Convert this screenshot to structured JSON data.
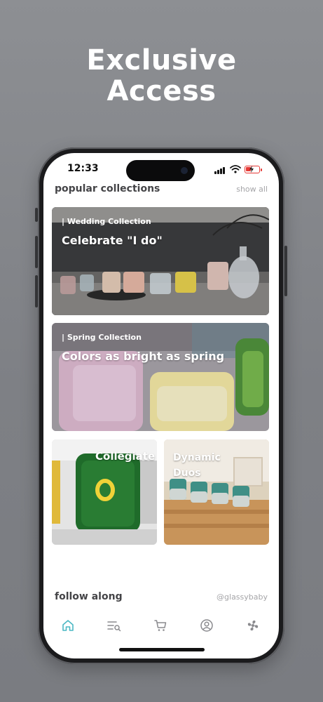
{
  "headline": {
    "line1": "Exclusive",
    "line2": "Access"
  },
  "status_bar": {
    "time": "12:33",
    "battery_level": 0.4,
    "battery_color": "#e53935"
  },
  "popular": {
    "title": "popular collections",
    "link": "show all",
    "cards": [
      {
        "tag": "| Wedding Collection",
        "title": "Celebrate \"I do\""
      },
      {
        "tag": "| Spring Collection",
        "title": "Colors as bright as spring"
      },
      {
        "title": "Collegiate"
      },
      {
        "title": "Dynamic Duos"
      }
    ]
  },
  "follow": {
    "title": "follow along",
    "handle": "@glassybaby"
  },
  "tabs": [
    {
      "icon": "home-icon",
      "active": true
    },
    {
      "icon": "search-list-icon",
      "active": false
    },
    {
      "icon": "cart-icon",
      "active": false
    },
    {
      "icon": "profile-icon",
      "active": false
    },
    {
      "icon": "pinwheel-icon",
      "active": false
    }
  ],
  "colors": {
    "accent": "#4bb8c4",
    "icon": "#8a8a8e",
    "heading": "#444447"
  }
}
